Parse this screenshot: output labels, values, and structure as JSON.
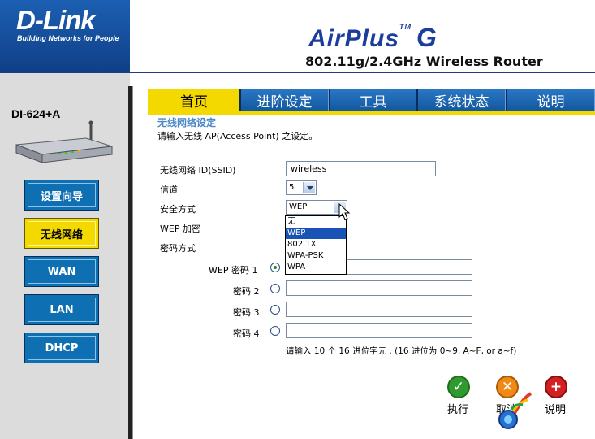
{
  "brand": {
    "name": "D-Link",
    "tagline": "Building Networks for People"
  },
  "product": {
    "series": "AirPlus",
    "tm": "TM",
    "letter": "G",
    "model_line": "802.11g/2.4GHz Wireless Router"
  },
  "device_model": "DI-624+A",
  "sidebar": {
    "items": [
      {
        "label": "设置向导"
      },
      {
        "label": "无线网络"
      },
      {
        "label": "WAN"
      },
      {
        "label": "LAN"
      },
      {
        "label": "DHCP"
      }
    ]
  },
  "tabs": [
    {
      "label": "首页"
    },
    {
      "label": "进阶设定"
    },
    {
      "label": "工具"
    },
    {
      "label": "系统状态"
    },
    {
      "label": "说明"
    }
  ],
  "section": {
    "title": "无线网络设定",
    "description": "请输入无线 AP(Access Point) 之设定。"
  },
  "form": {
    "ssid_label": "无线网络 ID(SSID)",
    "ssid_value": "wireless",
    "channel_label": "信道",
    "channel_value": "5",
    "security_label": "安全方式",
    "security_value": "WEP",
    "security_options": [
      "无",
      "WEP",
      "802.1X",
      "WPA-PSK",
      "WPA"
    ],
    "wep_encrypt_label": "WEP 加密",
    "key_mode_label": "密码方式",
    "keys": [
      {
        "label": "WEP 密码  1",
        "selected": true
      },
      {
        "label": "密码  2",
        "selected": false
      },
      {
        "label": "密码  3",
        "selected": false
      },
      {
        "label": "密码  4",
        "selected": false
      }
    ],
    "hint": "请输入  10 个  16 进位字元  . (16 进位为  0~9, A~F, or a~f)"
  },
  "actions": {
    "apply": "执行",
    "cancel": "取消",
    "help": "说明"
  },
  "colors": {
    "brand_blue": "#1c5fb2",
    "tab_blue": "#1b63b2",
    "active_yellow": "#f4d900",
    "section_blue": "#4b87c4"
  }
}
